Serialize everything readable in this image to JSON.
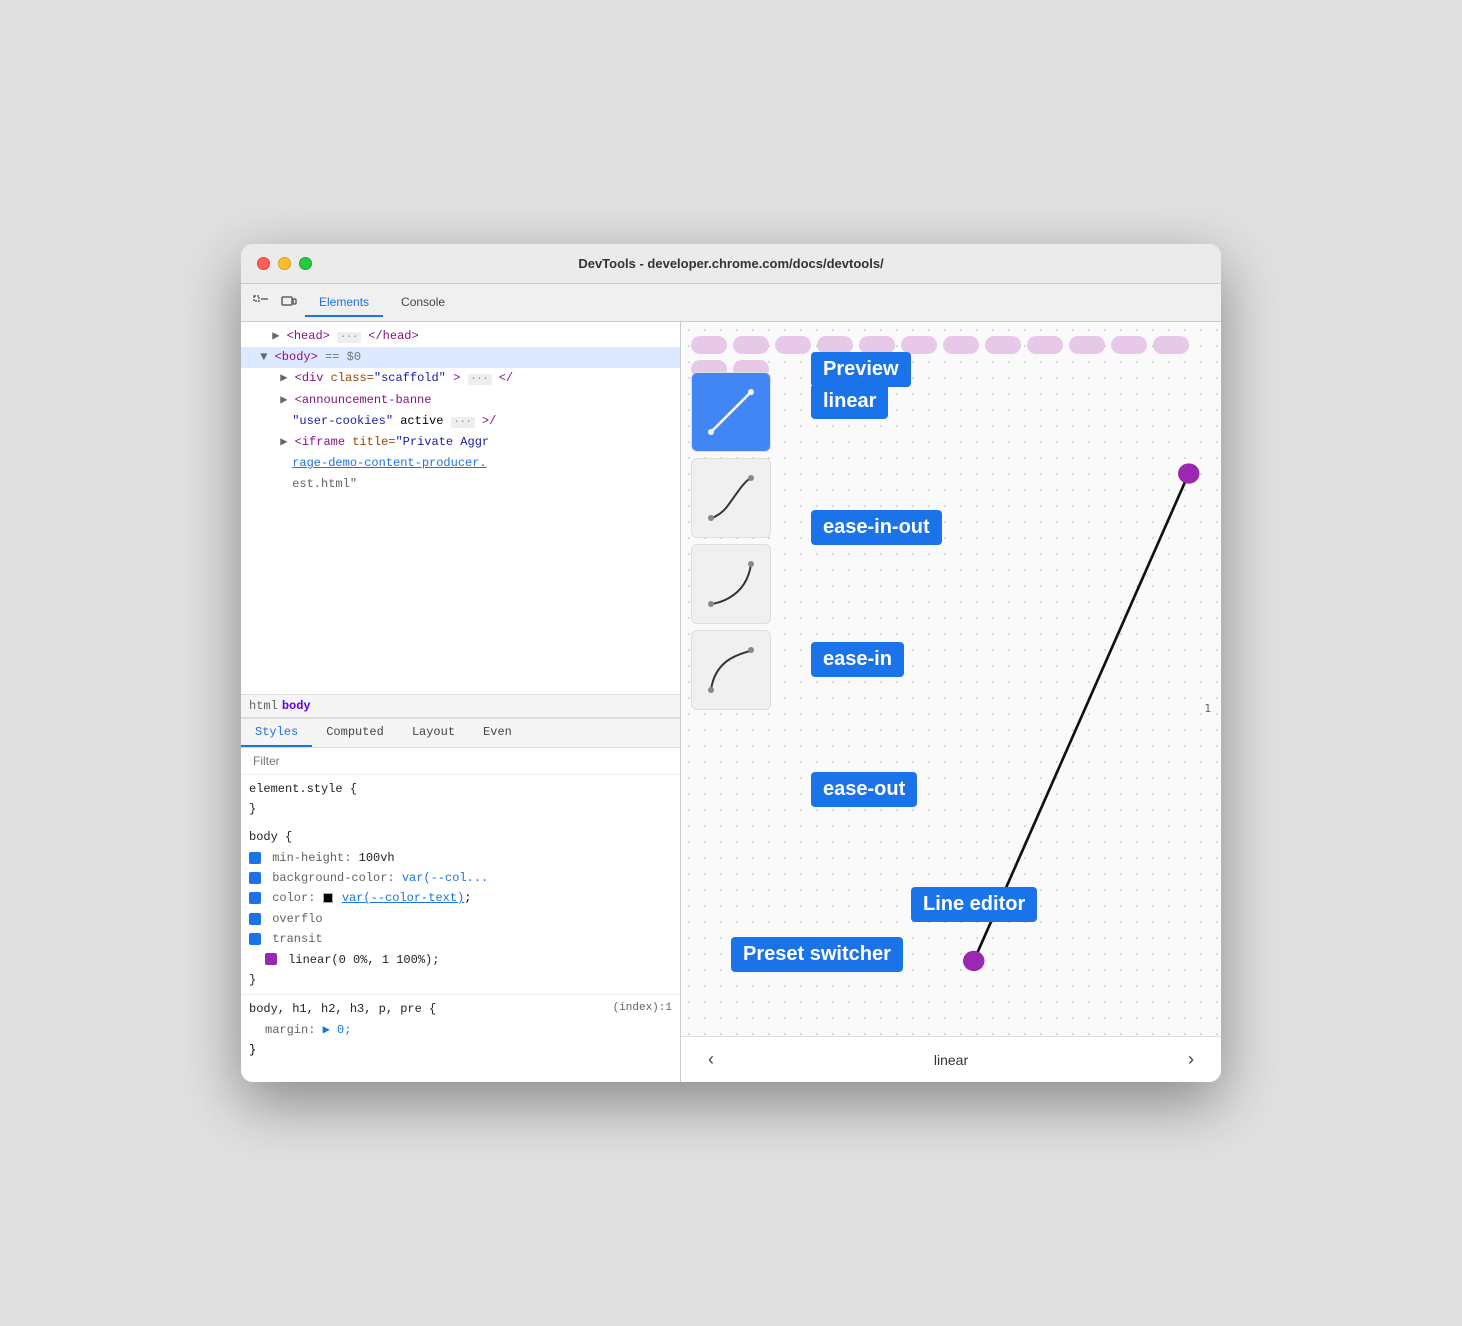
{
  "window": {
    "title": "DevTools - developer.chrome.com/docs/devtools/"
  },
  "titlebar": {
    "title": "DevTools - developer.chrome.com/docs/devtools/"
  },
  "devtools_tabs": {
    "tabs": [
      {
        "label": "Elements",
        "active": true
      },
      {
        "label": "Console",
        "active": false
      }
    ]
  },
  "dom_tree": {
    "lines": [
      {
        "text": "▶ <head> ··· </head>",
        "indent": 4
      },
      {
        "text": "▼ <body> == $0",
        "indent": 2,
        "selected": true
      },
      {
        "text": "▶ <div class=\"scaffold\"> ··· </",
        "indent": 6
      },
      {
        "text": "▶ <announcement-banne",
        "indent": 6
      },
      {
        "text": "  \"user-cookies\" active ··· >/",
        "indent": 8
      },
      {
        "text": "▶ <iframe title=\"Private Aggr",
        "indent": 6
      },
      {
        "text": "rage-demo-content-producer.",
        "indent": 8,
        "link": true
      },
      {
        "text": "est.html\"",
        "indent": 8
      }
    ]
  },
  "breadcrumb": {
    "items": [
      {
        "label": "html",
        "active": false
      },
      {
        "label": "body",
        "active": true
      }
    ]
  },
  "styles_tabs": {
    "tabs": [
      {
        "label": "Styles",
        "active": true
      },
      {
        "label": "Computed",
        "active": false
      },
      {
        "label": "Layout",
        "active": false
      },
      {
        "label": "Even",
        "active": false
      }
    ]
  },
  "filter": {
    "placeholder": "Filter"
  },
  "css_rules": [
    {
      "selector": "element.style {",
      "properties": [],
      "close": "}"
    },
    {
      "selector": "body {",
      "properties": [
        {
          "name": "min-height:",
          "value": "100vh",
          "checked": true,
          "color": null
        },
        {
          "name": "background-color:",
          "value": "var(--col...",
          "checked": true,
          "color": null
        },
        {
          "name": "color:",
          "value": "var(--color-text);",
          "checked": true,
          "color": "#000"
        },
        {
          "name": "overflo",
          "value": "",
          "checked": true,
          "truncated": true
        },
        {
          "name": "transit",
          "value": "",
          "checked": true,
          "truncated": true
        },
        {
          "name": "linear(0 0%, 1 100%);",
          "value": "",
          "checked": true,
          "purple": true
        }
      ],
      "close": "}"
    }
  ],
  "extra_rules": {
    "selector": "body, h1, h2, h3, p, pre {",
    "property": "margin:",
    "value": "▶ 0;",
    "close": "}",
    "source": "(index):1"
  },
  "preview": {
    "presets": [
      {
        "id": "linear",
        "active": true
      },
      {
        "id": "ease-in-out",
        "active": false
      },
      {
        "id": "ease-in",
        "active": false
      },
      {
        "id": "ease-out",
        "active": false
      }
    ],
    "nav": {
      "prev": "‹",
      "current": "linear",
      "next": "›"
    }
  },
  "annotations": {
    "preview": "Preview",
    "linear": "linear",
    "ease_in_out": "ease-in-out",
    "ease_in": "ease-in",
    "ease_out": "ease-out",
    "preset_switcher": "Preset switcher",
    "line_editor": "Line editor"
  }
}
